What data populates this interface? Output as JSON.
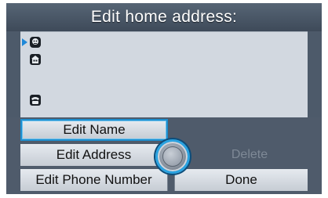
{
  "header": {
    "title": "Edit home address:"
  },
  "entries": [
    {
      "icon": "contact-person-icon",
      "selected": true
    },
    {
      "icon": "home-building-icon",
      "selected": false
    },
    {
      "icon": "telephone-icon",
      "selected": false
    }
  ],
  "menu": {
    "edit_name_label": "Edit Name",
    "edit_address_label": "Edit Address",
    "edit_phone_label": "Edit Phone Number",
    "delete_label": "Delete",
    "done_label": "Done"
  },
  "colors": {
    "highlight": "#1e8ecf",
    "background": "#4d5a6a",
    "panel": "#d2d8e0",
    "disabled_text": "#7e8996"
  }
}
